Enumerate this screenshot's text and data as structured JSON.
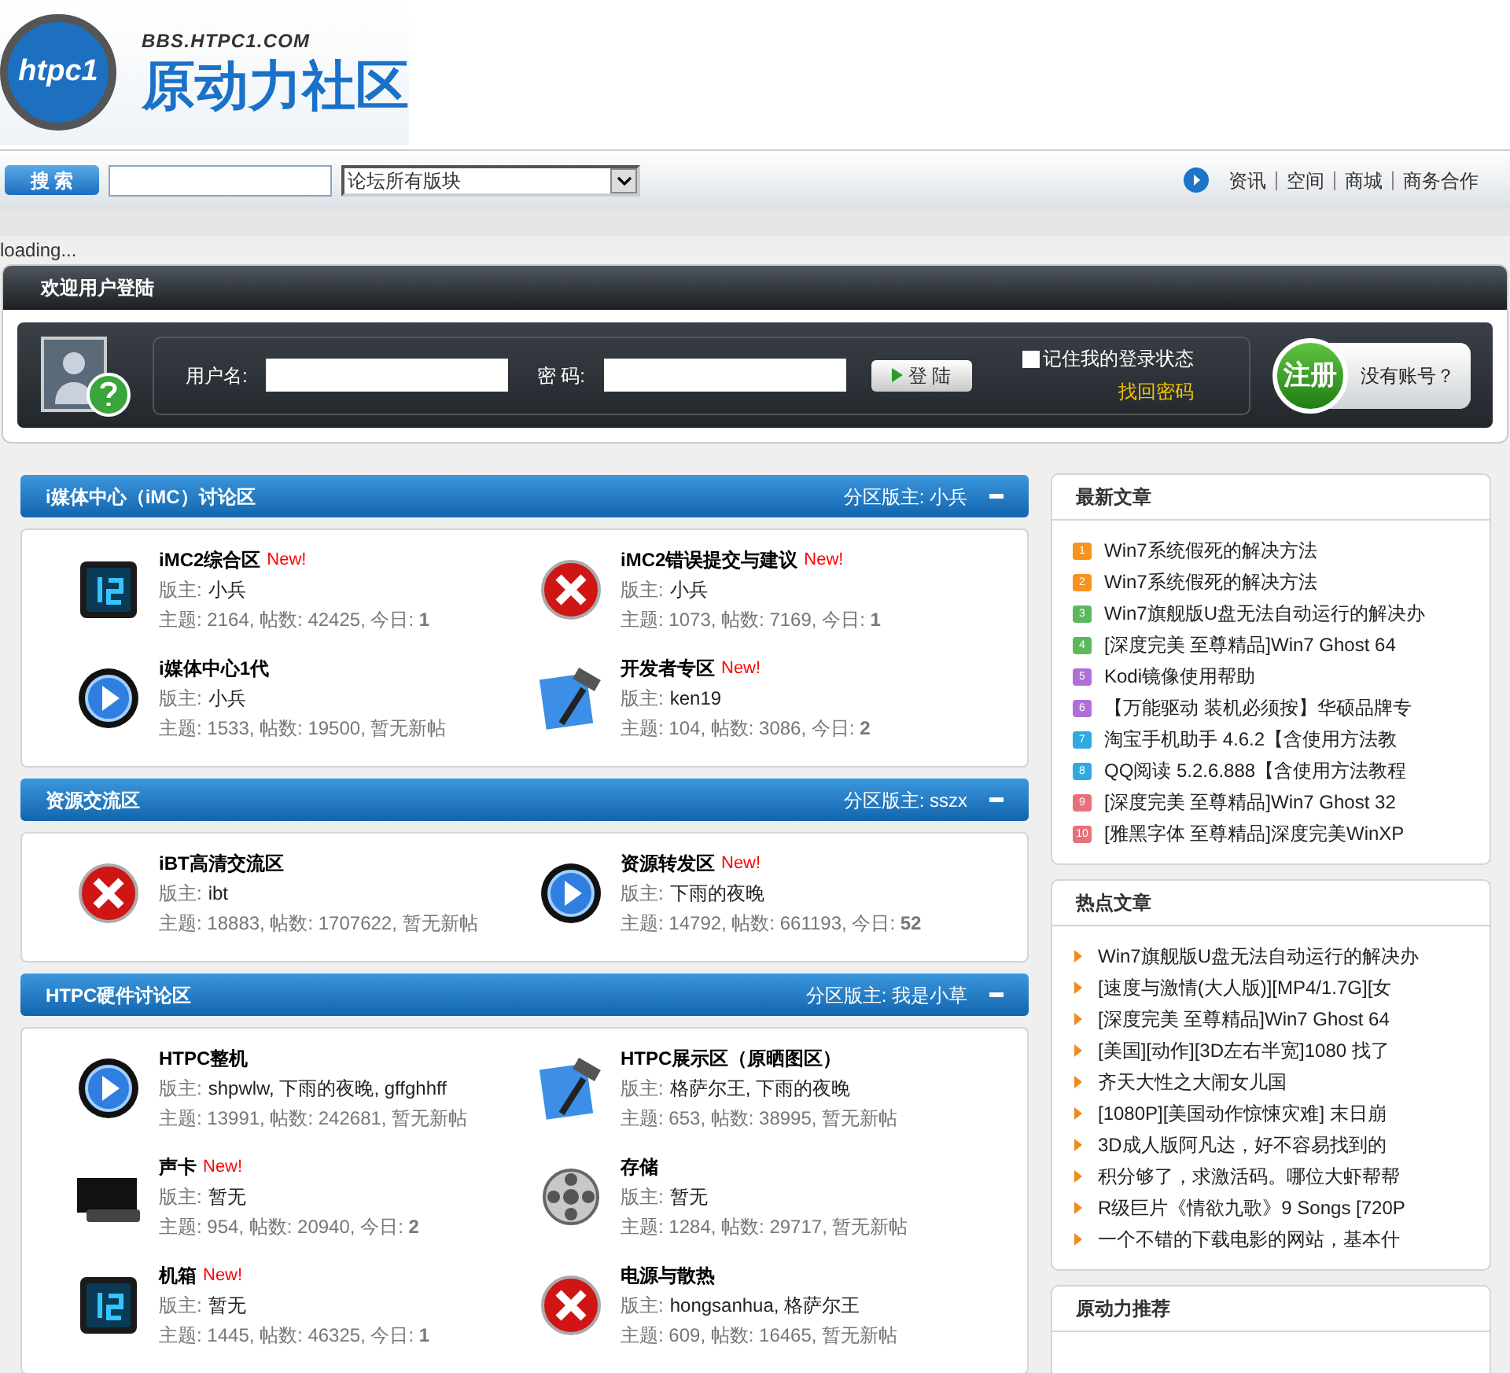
{
  "logo": {
    "badge": "htpc1",
    "url": "BBS.HTPC1.COM",
    "name": "原动力社区"
  },
  "search": {
    "button": "搜 索",
    "scope": "论坛所有版块"
  },
  "top_links": [
    "资讯",
    "空间",
    "商城",
    "商务合作"
  ],
  "loading": "loading...",
  "login": {
    "title": "欢迎用户登陆",
    "username_label": "用户名:",
    "password_label": "密 码:",
    "submit": "登 陆",
    "remember": {
      "label": "记住我的登录状态",
      "checked": false
    },
    "forgot": "找回密码",
    "register": "注册",
    "no_account": "没有账号？"
  },
  "sections": [
    {
      "title": "i媒体中心（iMC）讨论区",
      "moderator": "分区版主: 小兵",
      "forums": [
        {
          "name": "iMC2综合区",
          "badge": "New!",
          "mod_label": "版主:",
          "mods": "小兵",
          "stats": "主题: 2164, 帖数: 42425, 今日: **1**"
        },
        {
          "name": "iMC2错误提交与建议",
          "badge": "New!",
          "mod_label": "版主:",
          "mods": "小兵",
          "stats": "主题: 1073, 帖数: 7169, 今日: **1**"
        },
        {
          "name": "i媒体中心1代",
          "mod_label": "版主:",
          "mods": "小兵",
          "stats": "主题: 1533, 帖数: 19500, 暂无新帖"
        },
        {
          "name": "开发者专区",
          "badge": "New!",
          "mod_label": "版主:",
          "mods": "ken19",
          "stats": "主题: 104, 帖数: 3086, 今日: **2**"
        }
      ]
    },
    {
      "title": "资源交流区",
      "moderator": "分区版主: sszx",
      "forums": [
        {
          "name": "iBT高清交流区",
          "mod_label": "版主:",
          "mods": "ibt",
          "stats": "主题: 18883, 帖数: 1707622, 暂无新帖"
        },
        {
          "name": "资源转发区",
          "badge": "New!",
          "mod_label": "版主:",
          "mods": "下雨的夜晚",
          "stats": "主题: 14792, 帖数: 661193, 今日: **52**"
        }
      ]
    },
    {
      "title": "HTPC硬件讨论区",
      "moderator": "分区版主: 我是小草",
      "forums": [
        {
          "name": "HTPC整机",
          "mod_label": "版主:",
          "mods": "shpwlw, 下雨的夜晚, gffghhff",
          "stats": "主题: 13991, 帖数: 242681, 暂无新帖"
        },
        {
          "name": "HTPC展示区（原晒图区）",
          "mod_label": "版主:",
          "mods": "格萨尔王, 下雨的夜晚",
          "stats": "主题: 653, 帖数: 38995, 暂无新帖"
        },
        {
          "name": "声卡",
          "badge": "New!",
          "mod_label": "版主:",
          "mods": "暂无",
          "stats": "主题: 954, 帖数: 20940, 今日: **2**"
        },
        {
          "name": "存储",
          "mod_label": "版主:",
          "mods": "暂无",
          "stats": "主题: 1284, 帖数: 29717, 暂无新帖"
        },
        {
          "name": "机箱",
          "badge": "New!",
          "mod_label": "版主:",
          "mods": "暂无",
          "stats": "主题: 1445, 帖数: 46325, 今日: **1**"
        },
        {
          "name": "电源与散热",
          "mod_label": "版主:",
          "mods": "hongsanhua, 格萨尔王",
          "stats": "主题: 609, 帖数: 16465, 暂无新帖"
        }
      ]
    }
  ],
  "latest": {
    "title": "最新文章",
    "items": [
      {
        "rank": "1",
        "color": "#f7931e",
        "text": "Win7系统假死的解决方法"
      },
      {
        "rank": "2",
        "color": "#f7931e",
        "text": "Win7系统假死的解决方法"
      },
      {
        "rank": "3",
        "color": "#5cb85c",
        "text": "Win7旗舰版U盘无法自动运行的解决办"
      },
      {
        "rank": "4",
        "color": "#5cb85c",
        "text": "[深度完美 至尊精品]Win7 Ghost 64"
      },
      {
        "rank": "5",
        "color": "#b06fd8",
        "text": "Kodi镜像使用帮助"
      },
      {
        "rank": "6",
        "color": "#b06fd8",
        "text": "【万能驱动 装机必须按】华硕品牌专"
      },
      {
        "rank": "7",
        "color": "#2fa9e0",
        "text": "淘宝手机助手 4.6.2【含使用方法教"
      },
      {
        "rank": "8",
        "color": "#2fa9e0",
        "text": "QQ阅读 5.2.6.888【含使用方法教程"
      },
      {
        "rank": "9",
        "color": "#e8707a",
        "text": "[深度完美 至尊精品]Win7 Ghost 32"
      },
      {
        "rank": "10",
        "color": "#e8707a",
        "text": "[雅黑字体 至尊精品]深度完美WinXP"
      }
    ]
  },
  "hot": {
    "title": "热点文章",
    "items": [
      "Win7旗舰版U盘无法自动运行的解决办",
      "[速度与激情(大人版)][MP4/1.7G][女",
      "[深度完美 至尊精品]Win7 Ghost 64",
      "[美国][动作][3D左右半宽]1080 找了",
      "齐天大性之大闹女儿国",
      "[1080P][美国动作惊悚灾难] 末日崩",
      "3D成人版阿凡达，好不容易找到的",
      "积分够了，求激活码。哪位大虾帮帮",
      "R级巨片《情欲九歌》9 Songs [720P",
      "一个不错的下载电影的网站，基本什"
    ]
  },
  "recommend": {
    "title": "原动力推荐"
  }
}
